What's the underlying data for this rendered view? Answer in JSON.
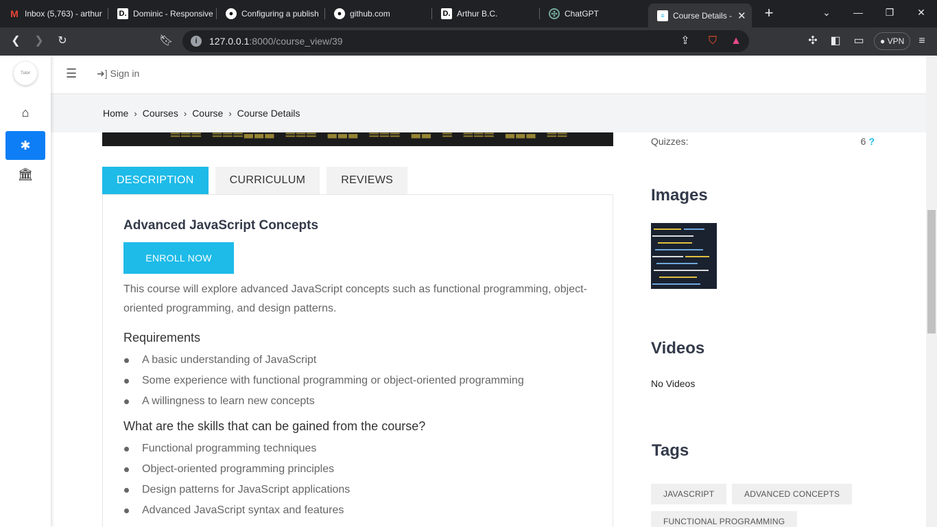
{
  "browser": {
    "tabs": [
      {
        "title": "Inbox (5,763) - arthur",
        "icon": "gmail-icon"
      },
      {
        "title": "Dominic - Responsive",
        "icon": "dev-icon"
      },
      {
        "title": "Configuring a publish",
        "icon": "github-icon"
      },
      {
        "title": "github.com",
        "icon": "github-icon"
      },
      {
        "title": "Arthur B.C.",
        "icon": "dev-icon"
      },
      {
        "title": "ChatGPT",
        "icon": "chatgpt-icon"
      },
      {
        "title": "Course Details -",
        "icon": "page-icon",
        "active": true
      }
    ],
    "url_host": "127.0.0.1",
    "url_rest": ":8000/course_view/39",
    "vpn_label": "VPN"
  },
  "header": {
    "logo_text": "Tutor",
    "signin_label": "Sign in"
  },
  "breadcrumb": [
    "Home",
    "Courses",
    "Course",
    "Course Details"
  ],
  "course_tabs": [
    "DESCRIPTION",
    "CURRICULUM",
    "REVIEWS"
  ],
  "course": {
    "title": "Advanced JavaScript Concepts",
    "enroll_label": "ENROLL NOW",
    "description": "This course will explore advanced JavaScript concepts such as functional programming, object-oriented programming, and design patterns.",
    "requirements_heading": "Requirements",
    "requirements": [
      "A basic understanding of JavaScript",
      "Some experience with functional programming or object-oriented programming",
      "A willingness to learn new concepts"
    ],
    "skills_heading": "What are the skills that can be gained from the course?",
    "skills": [
      "Functional programming techniques",
      "Object-oriented programming principles",
      "Design patterns for JavaScript applications",
      "Advanced JavaScript syntax and features"
    ]
  },
  "sidebar_info": {
    "quizzes_label": "Quizzes:",
    "quizzes_value": "6",
    "quizzes_help": "?",
    "images_heading": "Images",
    "videos_heading": "Videos",
    "no_videos": "No Videos",
    "tags_heading": "Tags",
    "tags": [
      "JAVASCRIPT",
      "ADVANCED CONCEPTS",
      "FUNCTIONAL PROGRAMMING"
    ]
  },
  "colors": {
    "accent": "#1ebbe8",
    "sidebar_active": "#0d7ef5"
  }
}
